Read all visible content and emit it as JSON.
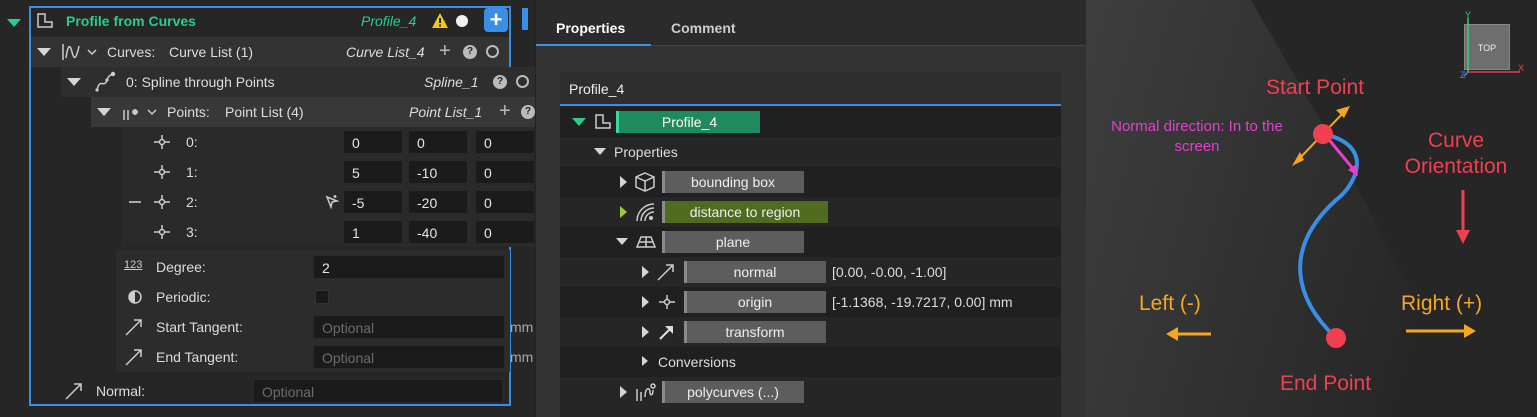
{
  "left": {
    "root": {
      "title": "Profile from Curves",
      "type": "Profile_4"
    },
    "curves": {
      "label": "Curves:",
      "value": "Curve List (1)",
      "type": "Curve List_4"
    },
    "spline": {
      "label": "0:  Spline through Points",
      "type": "Spline_1"
    },
    "points": {
      "label": "Points:",
      "value": "Point List (4)",
      "type": "Point List_1",
      "rows": [
        {
          "idx": "0:",
          "x": "0",
          "y": "0",
          "z": "0"
        },
        {
          "idx": "1:",
          "x": "5",
          "y": "-10",
          "z": "0"
        },
        {
          "idx": "2:",
          "x": "-5",
          "y": "-20",
          "z": "0"
        },
        {
          "idx": "3:",
          "x": "1",
          "y": "-40",
          "z": "0"
        }
      ]
    },
    "degree": {
      "label": "Degree:",
      "value": "2"
    },
    "periodic": {
      "label": "Periodic:"
    },
    "start_tangent": {
      "label": "Start Tangent:",
      "placeholder": "Optional",
      "unit": "mm"
    },
    "end_tangent": {
      "label": "End Tangent:",
      "placeholder": "Optional",
      "unit": "mm"
    },
    "normal": {
      "label": "Normal:",
      "placeholder": "Optional"
    }
  },
  "middle": {
    "tabs": [
      "Properties",
      "Comment"
    ],
    "header": "Profile_4",
    "root_name": "Profile_4",
    "properties_label": "Properties",
    "items": {
      "bounding_box": "bounding box",
      "distance": "distance to region",
      "plane": "plane",
      "normal": "normal",
      "normal_value": "[0.00, -0.00, -1.00]",
      "origin": "origin",
      "origin_value": "[-1.1368, -19.7217, 0.00] mm",
      "transform": "transform",
      "conversions": "Conversions",
      "polycurves": "polycurves (...)"
    }
  },
  "viewport": {
    "start_point": "Start Point",
    "end_point": "End Point",
    "normal_note": "Normal direction: In to the screen",
    "curve_orientation": "Curve Orientation",
    "left": "Left (-)",
    "right": "Right (+)",
    "cube_label": "TOP",
    "axis_y": "Y",
    "axis_x": "X",
    "axis_z": "Z"
  },
  "colors": {
    "accent": "#3a8ee6",
    "green": "#2ecc8a",
    "red": "#f04050",
    "orange": "#f5a623",
    "magenta": "#e43fd0"
  }
}
